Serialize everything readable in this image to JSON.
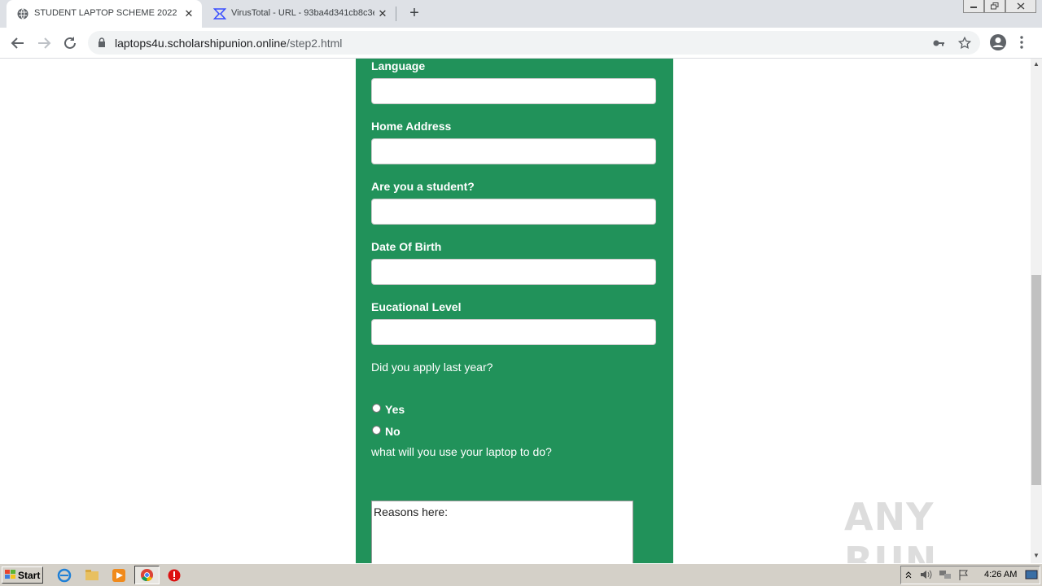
{
  "browser": {
    "tabs": [
      {
        "title": "STUDENT LAPTOP SCHEME 2022",
        "active": true,
        "icon": "globe-icon"
      },
      {
        "title": "VirusTotal - URL - 93ba4d341cb8c3e",
        "active": false,
        "icon": "virustotal-icon"
      }
    ],
    "url_host": "laptops4u.scholarshipunion.online",
    "url_path": "/step2.html"
  },
  "form": {
    "fields": [
      {
        "label": "Language",
        "value": ""
      },
      {
        "label": "Home Address",
        "value": ""
      },
      {
        "label": "Are you a student?",
        "value": ""
      },
      {
        "label": "Date Of Birth",
        "value": ""
      },
      {
        "label": "Eucational Level",
        "value": ""
      }
    ],
    "apply_question": "Did you apply last year?",
    "radio_options": [
      "Yes",
      "No"
    ],
    "laptop_question": "what will you use your laptop to do?",
    "reasons_placeholder": "Reasons here:"
  },
  "watermark": "ANY RUN",
  "taskbar": {
    "start_label": "Start",
    "clock": "4:26 AM"
  },
  "colors": {
    "form_bg": "#21925a",
    "tabstrip_bg": "#dee1e6",
    "taskbar_bg": "#d4d0c8"
  }
}
